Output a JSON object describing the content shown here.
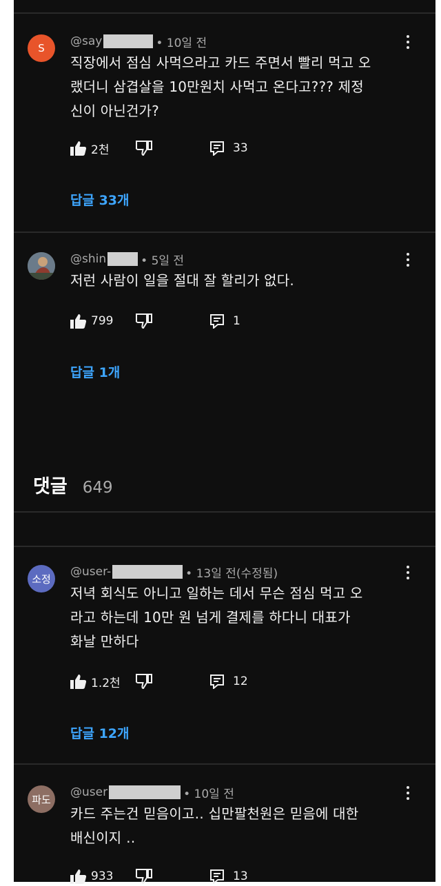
{
  "section": {
    "title": "댓글",
    "count": "649"
  },
  "comments": [
    {
      "avatar_text": "S",
      "avatar_color": "#e8542a",
      "handle": "@say",
      "time": "• 10일 전",
      "text": "직장에서 점심 사먹으라고 카드 주면서 빨리 먹고 오\n랬더니 삼겹살을 10만원치 사먹고 온다고??? 제정\n신이 아닌건가?",
      "likes": "2천",
      "replies_count": "33",
      "replies_link": "답글 33개"
    },
    {
      "avatar_text": "",
      "avatar_color": "#5a6a55",
      "handle": "@shin",
      "time": "• 5일 전",
      "text": "저런 사람이 일을 절대 잘 할리가 없다.",
      "likes": "799",
      "replies_count": "1",
      "replies_link": "답글 1개"
    },
    {
      "avatar_text": "소정",
      "avatar_color": "#5c6bc0",
      "handle": "@user-",
      "time": "• 13일 전(수정됨)",
      "text": "저녁 회식도 아니고  일하는 데서  무슨 점심 먹고 오\n라고  하는데  10만 원  넘게  결제를  하다니 대표가\n화날 만하다",
      "likes": "1.2천",
      "replies_count": "12",
      "replies_link": "답글 12개"
    },
    {
      "avatar_text": "파도",
      "avatar_color": "#8d6e63",
      "handle": "@user",
      "time": "• 10일 전",
      "text": "카드 주는건 믿음이고‥  십만팔천원은 믿음에 대한\n배신이지 ‥",
      "likes": "933",
      "replies_count": "13",
      "replies_link": ""
    }
  ]
}
